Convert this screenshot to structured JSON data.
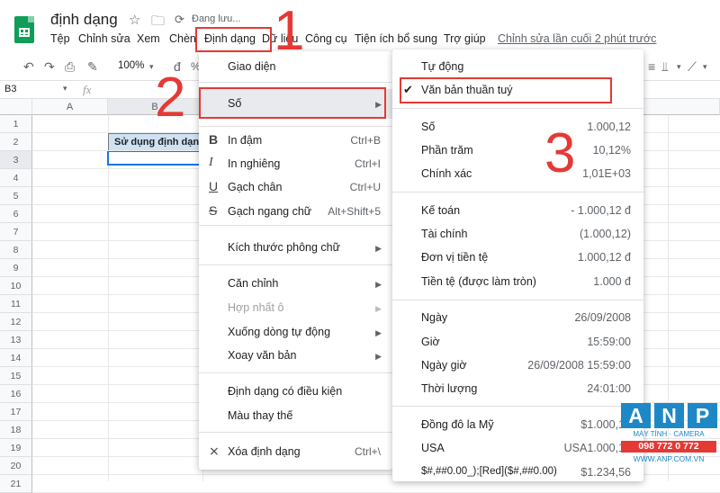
{
  "app": {
    "doc_title": "định dạng",
    "saving_status": "Đang lưu...",
    "last_edit": "Chỉnh sửa lần cuối 2 phút trước",
    "menus": [
      "Tệp",
      "Chỉnh sửa",
      "Xem",
      "Chèn",
      "Định dạng",
      "Dữ liệu",
      "Công cụ",
      "Tiện ích bổ sung",
      "Trợ giúp"
    ]
  },
  "toolbar": {
    "zoom": "100%",
    "percent": "%"
  },
  "formula_bar": {
    "name_box": "B3",
    "fx": "fx"
  },
  "sheet": {
    "columns": [
      "A",
      "B"
    ],
    "rows": [
      "1",
      "2",
      "3",
      "4",
      "5",
      "6",
      "7",
      "8",
      "9",
      "10",
      "11",
      "12",
      "13",
      "14",
      "15",
      "16",
      "17",
      "18",
      "19",
      "20",
      "21"
    ],
    "cell_b2": "Sử dụng định dạng"
  },
  "format_menu": {
    "theme": "Giao diện",
    "number": "Số",
    "bold": {
      "label": "In đậm",
      "shortcut": "Ctrl+B"
    },
    "italic": {
      "label": "In nghiêng",
      "shortcut": "Ctrl+I"
    },
    "underline": {
      "label": "Gạch chân",
      "shortcut": "Ctrl+U"
    },
    "strikethrough": {
      "label": "Gạch ngang chữ",
      "shortcut": "Alt+Shift+5"
    },
    "font_size": "Kích thước phông chữ",
    "align": "Căn chỉnh",
    "merge": "Hợp nhất ô",
    "wrap": "Xuống dòng tự động",
    "rotate": "Xoay văn bản",
    "conditional": "Định dạng có điều kiện",
    "alternating": "Màu thay thế",
    "clear": {
      "label": "Xóa định dạng",
      "shortcut": "Ctrl+\\"
    }
  },
  "number_menu": {
    "automatic": "Tự động",
    "plain_text": "Văn bản thuần tuý",
    "items": [
      {
        "label": "Số",
        "value": "1.000,12"
      },
      {
        "label": "Phần trăm",
        "value": "10,12%"
      },
      {
        "label": "Chính xác",
        "value": "1,01E+03"
      },
      {
        "label": "Kế toán",
        "value": "- 1.000,12 đ"
      },
      {
        "label": "Tài chính",
        "value": "(1.000,12)"
      },
      {
        "label": "Đơn vị tiền tệ",
        "value": "1.000,12 đ"
      },
      {
        "label": "Tiền tệ (được làm tròn)",
        "value": "1.000 đ"
      },
      {
        "label": "Ngày",
        "value": "26/09/2008"
      },
      {
        "label": "Giờ",
        "value": "15:59:00"
      },
      {
        "label": "Ngày giờ",
        "value": "26/09/2008 15:59:00"
      },
      {
        "label": "Thời lượng",
        "value": "24:01:00"
      },
      {
        "label": "Đồng đô la Mỹ",
        "value": "$1.000,12"
      },
      {
        "label": "USA",
        "value": "USA1.000,12"
      },
      {
        "label": "$#,##0.00_);[Red]($#,##0.00)",
        "value": "$1.234,56"
      }
    ]
  },
  "annotations": [
    "1",
    "2",
    "3"
  ],
  "watermark": {
    "letters": [
      "A",
      "N",
      "P"
    ],
    "tagline": "MÁY TÍNH · CAMERA",
    "phone": "098 772 0 772",
    "website": "WWW.ANP.COM.VN"
  },
  "colors": {
    "accent": "#1a73e8",
    "annotation_red": "#e53935",
    "sheets_green": "#0f9d58",
    "watermark_blue": "#1e88c7"
  }
}
